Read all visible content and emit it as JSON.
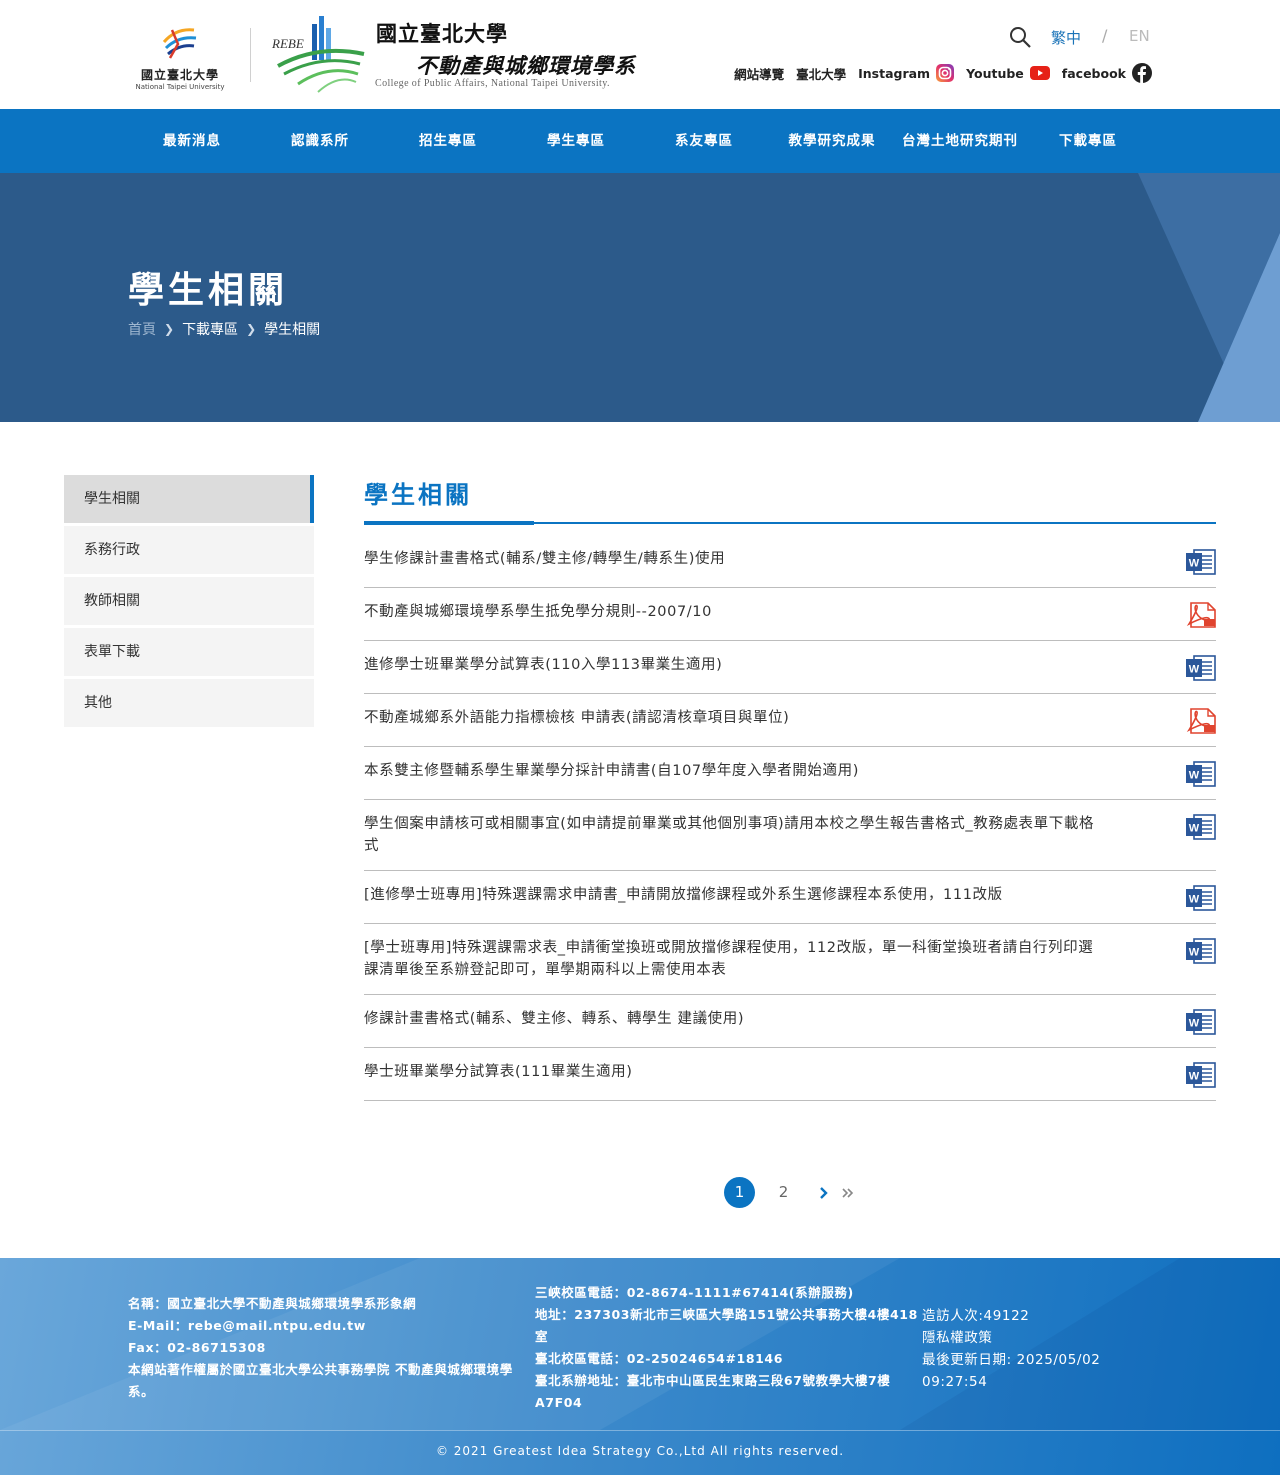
{
  "header": {
    "ntpu_name": "國立臺北大學",
    "ntpu_en": "National Taipei University",
    "rebe_label": "REBE",
    "dept_line1": "國立臺北大學",
    "dept_line2": "不動產與城鄉環境學系",
    "dept_en": "College of Public Affairs, National Taipei University.",
    "lang_zh": "繁中",
    "lang_sep": "/",
    "lang_en": "EN",
    "links": {
      "sitemap": "網站導覽",
      "ntpu": "臺北大學",
      "instagram": "Instagram",
      "youtube": "Youtube",
      "facebook": "facebook"
    }
  },
  "nav": [
    "最新消息",
    "認識系所",
    "招生專區",
    "學生專區",
    "系友專區",
    "教學研究成果",
    "台灣土地研究期刊",
    "下載專區"
  ],
  "banner": {
    "title": "學生相關",
    "breadcrumb": [
      "首頁",
      "下載專區",
      "學生相關"
    ]
  },
  "sidebar": [
    "學生相關",
    "系務行政",
    "教師相關",
    "表單下載",
    "其他"
  ],
  "main": {
    "title": "學生相關",
    "files": [
      {
        "name": "學生修課計畫書格式(輔系/雙主修/轉學生/轉系生)使用",
        "icon": "word-icon"
      },
      {
        "name": "不動產與城鄉環境學系學生抵免學分規則--2007/10",
        "icon": "pdf-icon"
      },
      {
        "name": "進修學士班畢業學分試算表(110入學113畢業生適用)",
        "icon": "word-icon"
      },
      {
        "name": "不動產城鄉系外語能力指標檢核 申請表(請認清核章項目與單位)",
        "icon": "pdf-icon"
      },
      {
        "name": "本系雙主修暨輔系學生畢業學分採計申請書(自107學年度入學者開始適用)",
        "icon": "word-icon"
      },
      {
        "name": "學生個案申請核可或相關事宜(如申請提前畢業或其他個別事項)請用本校之學生報告書格式_教務處表單下載格式",
        "icon": "word-icon"
      },
      {
        "name": "[進修學士班專用]特殊選課需求申請書_申請開放擋修課程或外系生選修課程本系使用，111改版",
        "icon": "word-icon"
      },
      {
        "name": "[學士班專用]特殊選課需求表_申請衝堂換班或開放擋修課程使用，112改版，單一科衝堂換班者請自行列印選課清單後至系辦登記即可，單學期兩科以上需使用本表",
        "icon": "word-icon"
      },
      {
        "name": "修課計畫書格式(輔系、雙主修、轉系、轉學生 建議使用)",
        "icon": "word-icon"
      },
      {
        "name": "學士班畢業學分試算表(111畢業生適用)",
        "icon": "word-icon"
      }
    ]
  },
  "pagination": {
    "pages": [
      "1",
      "2"
    ],
    "current": "1"
  },
  "footer": {
    "col1": [
      "名稱：國立臺北大學不動產與城鄉環境學系形象網",
      "E-Mail：rebe@mail.ntpu.edu.tw",
      "Fax：02-86715308",
      "本網站著作權屬於國立臺北大學公共事務學院 不動產與城鄉環境學系。"
    ],
    "col2": [
      "三峽校區電話：02-8674-1111#67414(系辦服務)",
      "地址：237303新北市三峽區大學路151號公共事務大樓4樓418室",
      "臺北校區電話：02-25024654#18146",
      "臺北系辦地址：臺北市中山區民生東路三段67號教學大樓7樓A7F04"
    ],
    "visitors": "造訪人次:49122",
    "privacy": "隱私權政策",
    "updated": "最後更新日期: 2025/05/02 09:27:54",
    "copyright": "© 2021 Greatest Idea Strategy Co.,Ltd All rights reserved."
  },
  "colors": {
    "primary": "#0b74c2",
    "banner": "#2c5a8a",
    "word": "#2b579a",
    "pdf": "#e0442f"
  }
}
